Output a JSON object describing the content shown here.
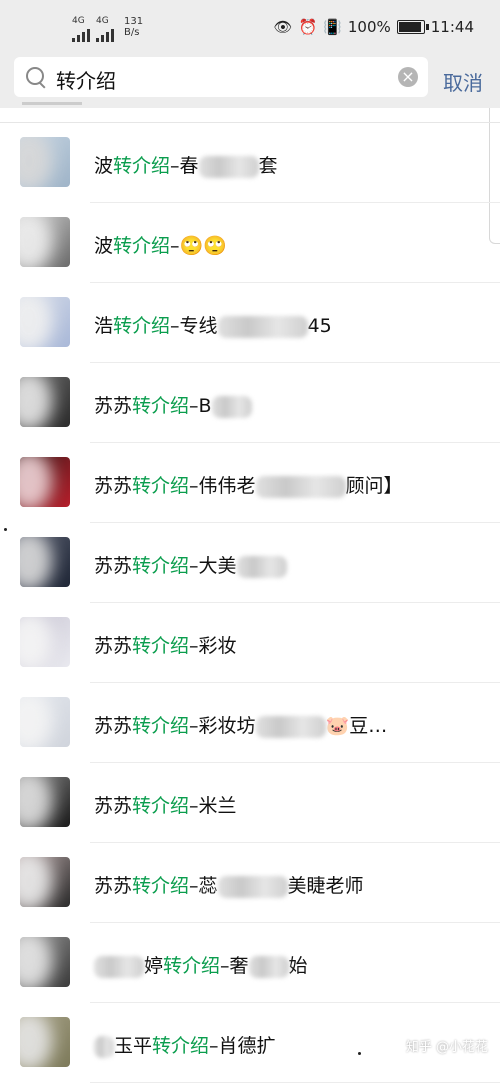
{
  "status": {
    "sim1": "4G",
    "sim2": "4G",
    "speed_value": "131",
    "speed_unit": "B/s",
    "battery": "100%",
    "time": "11:44"
  },
  "search": {
    "query": "转介绍",
    "cancel_label": "取消"
  },
  "results": [
    {
      "pre": "波",
      "hl": "转介绍",
      "post1": "–春",
      "mask": 60,
      "post2": "套"
    },
    {
      "pre": "波",
      "hl": "转介绍",
      "post1": "–🙄🙄",
      "mask": 0,
      "post2": ""
    },
    {
      "pre": "浩",
      "hl": "转介绍",
      "post1": "–专线",
      "mask": 90,
      "post2": "45"
    },
    {
      "pre": "苏苏",
      "hl": "转介绍",
      "post1": "–B",
      "mask": 40,
      "post2": ""
    },
    {
      "pre": "苏苏",
      "hl": "转介绍",
      "post1": "–伟伟老",
      "mask": 90,
      "post2": "顾问】"
    },
    {
      "pre": "苏苏",
      "hl": "转介绍",
      "post1": "–大美",
      "mask": 50,
      "post2": ""
    },
    {
      "pre": "苏苏",
      "hl": "转介绍",
      "post1": "–彩妆",
      "mask": 0,
      "post2": ""
    },
    {
      "pre": "苏苏",
      "hl": "转介绍",
      "post1": "–彩妆坊",
      "mask": 70,
      "post2": "🐷豆…"
    },
    {
      "pre": "苏苏",
      "hl": "转介绍",
      "post1": "–米兰",
      "mask": 0,
      "post2": ""
    },
    {
      "pre": "苏苏",
      "hl": "转介绍",
      "post1": "–蕊",
      "mask": 70,
      "post2": "美睫老师"
    },
    {
      "pre": "婷",
      "hl": "转介绍",
      "post1": "–奢",
      "mask": 40,
      "post2": "始",
      "lead_mask": 50
    },
    {
      "pre": "玉平",
      "hl": "转介绍",
      "post1": "–肖德扩",
      "mask": 0,
      "post2": "",
      "lead_mask": 20
    }
  ],
  "watermark": "知乎 @小花花"
}
